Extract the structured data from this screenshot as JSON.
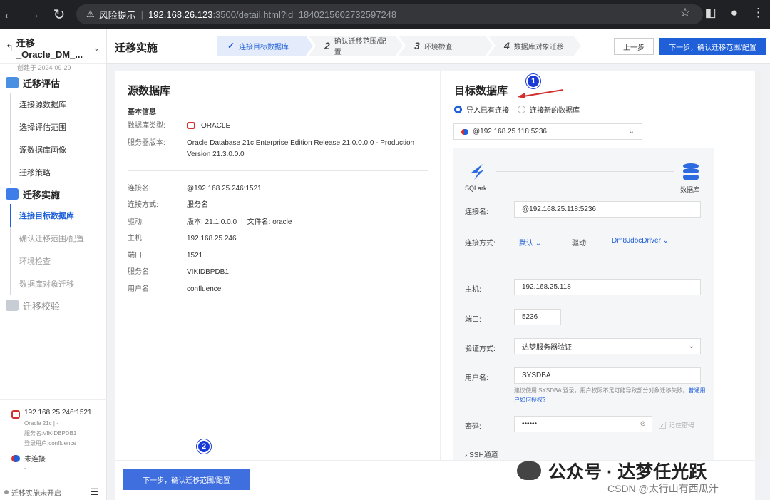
{
  "browser": {
    "warning": "风险提示",
    "url_host": "192.168.26.123",
    "url_rest": ":3500/detail.html?id=1840215602732597248"
  },
  "sidebar": {
    "title": "迁移_Oracle_DM_...",
    "created": "创建于 2024-09-29",
    "sections": [
      {
        "label": "迁移评估",
        "items": [
          "连接源数据库",
          "选择评估范围",
          "源数据库画像",
          "迁移策略"
        ]
      },
      {
        "label": "迁移实施",
        "items": [
          "连接目标数据库",
          "确认迁移范围/配置",
          "环境检查",
          "数据库对象迁移"
        ]
      },
      {
        "label": "迁移校验",
        "items": []
      }
    ],
    "conn_source": {
      "host": "192.168.25.246:1521",
      "line1": "Oracle 21c | -",
      "line2": "服务名:VIKIDBPDB1",
      "line3": "登录用户:confluence"
    },
    "conn_target": {
      "label": "未连接",
      "line1": "-"
    },
    "footer": "迁移实施未开启"
  },
  "topbar": {
    "title": "迁移实施",
    "steps": [
      {
        "num": "✓",
        "label": "连接目标数据库"
      },
      {
        "num": "2",
        "label": "确认迁移范围/配置"
      },
      {
        "num": "3",
        "label": "环境检查"
      },
      {
        "num": "4",
        "label": "数据库对象迁移"
      }
    ],
    "prev": "上一步",
    "next": "下一步，确认迁移范围/配置"
  },
  "source": {
    "title": "源数据库",
    "basic": "基本信息",
    "db_type_label": "数据库类型:",
    "db_type": "ORACLE",
    "version_label": "服务器版本:",
    "version": "Oracle Database 21c Enterprise Edition Release 21.0.0.0.0 - Production Version 21.3.0.0.0",
    "rows": [
      {
        "k": "连接名:",
        "v": "@192.168.25.246:1521"
      },
      {
        "k": "连接方式:",
        "v": "服务名"
      },
      {
        "k": "驱动:",
        "v": "版本: 21.1.0.0.0",
        "v2": "文件名: oracle"
      },
      {
        "k": "主机:",
        "v": "192.168.25.246"
      },
      {
        "k": "端口:",
        "v": "1521"
      },
      {
        "k": "服务名:",
        "v": "VIKIDBPDB1"
      },
      {
        "k": "用户名:",
        "v": "confluence"
      }
    ],
    "next": "下一步，确认迁移范围/配置"
  },
  "target": {
    "title": "目标数据库",
    "radio_existing": "导入已有连接",
    "radio_new": "连接新的数据库",
    "selected_conn": "@192.168.25.118:5236",
    "sqlark": "SQLark",
    "db_label": "数据库",
    "conn_name_label": "连接名:",
    "conn_name": "@192.168.25.118:5236",
    "conn_method_label": "连接方式:",
    "conn_method": "默认",
    "driver_label": "驱动:",
    "driver": "Dm8JdbcDriver",
    "host_label": "主机:",
    "host": "192.168.25.118",
    "port_label": "端口:",
    "port": "5236",
    "auth_label": "验证方式:",
    "auth": "达梦服务器验证",
    "user_label": "用户名:",
    "user": "SYSDBA",
    "hint": "建议使用 SYSDBA 登录，用户权限不足可能导致部分对象迁移失败。",
    "hint_link": "普通用户如何授权?",
    "pwd_label": "密码:",
    "pwd": "••••••",
    "remember": "记住密码",
    "ssh": "SSH通道"
  },
  "annotations": {
    "badge1": "1",
    "badge2": "2"
  },
  "watermark": {
    "line1": "公众号 · 达梦任光跃",
    "line2": "CSDN @太行山有西瓜汁"
  },
  "colors": {
    "primary": "#1f5fd8",
    "oracle": "#d32f2f",
    "badge": "#1a3ad6",
    "arrow": "#d32f2f"
  }
}
